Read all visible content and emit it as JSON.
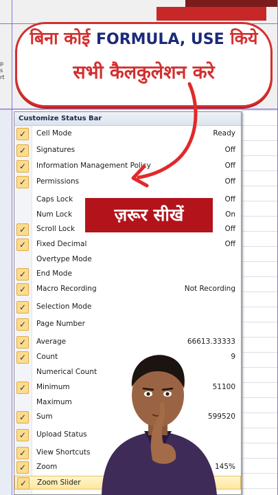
{
  "banner": {
    "line1_prefix": "बिना कोई ",
    "line1_english": "FORMULA, USE",
    "line1_suffix": " किये",
    "line2": "सभी कैलकुलेशन करे"
  },
  "badge": {
    "text": "ज़रूर सीखें"
  },
  "menu": {
    "title": "Customize Status Bar",
    "items": [
      {
        "label": "Cell Mode",
        "value": "Ready",
        "checked": true
      },
      {
        "label": "Signatures",
        "value": "Off",
        "checked": true
      },
      {
        "label": "Information Management Policy",
        "value": "Off",
        "checked": true
      },
      {
        "label": "Permissions",
        "value": "Off",
        "checked": true
      },
      {
        "label": "Caps Lock",
        "value": "Off",
        "checked": false
      },
      {
        "label": "Num Lock",
        "value": "On",
        "checked": false
      },
      {
        "label": "Scroll Lock",
        "value": "Off",
        "checked": true
      },
      {
        "label": "Fixed Decimal",
        "value": "Off",
        "checked": true
      },
      {
        "label": "Overtype Mode",
        "value": "",
        "checked": false
      },
      {
        "label": "End Mode",
        "value": "",
        "checked": true
      },
      {
        "label": "Macro Recording",
        "value": "Not Recording",
        "checked": true
      },
      {
        "label": "Selection Mode",
        "value": "",
        "checked": true
      },
      {
        "label": "Page Number",
        "value": "",
        "checked": true
      },
      {
        "label": "Average",
        "value": "66613.33333",
        "checked": true
      },
      {
        "label": "Count",
        "value": "9",
        "checked": true
      },
      {
        "label": "Numerical Count",
        "value": "",
        "checked": false
      },
      {
        "label": "Minimum",
        "value": "51100",
        "checked": true
      },
      {
        "label": "Maximum",
        "value": "",
        "checked": false
      },
      {
        "label": "Sum",
        "value": "599520",
        "checked": true
      },
      {
        "label": "Upload Status",
        "value": "",
        "checked": true
      },
      {
        "label": "View Shortcuts",
        "value": "",
        "checked": true
      },
      {
        "label": "Zoom",
        "value": "145%",
        "checked": true
      },
      {
        "label": "Zoom Slider",
        "value": "",
        "checked": true
      }
    ]
  },
  "left_edge_text": [
    "p",
    "s",
    "rt"
  ],
  "colors": {
    "accent_red": "#d32f2f",
    "check_fill": "#fcdc8c",
    "badge_red": "#b3141b",
    "english_blue": "#1b2a78"
  }
}
